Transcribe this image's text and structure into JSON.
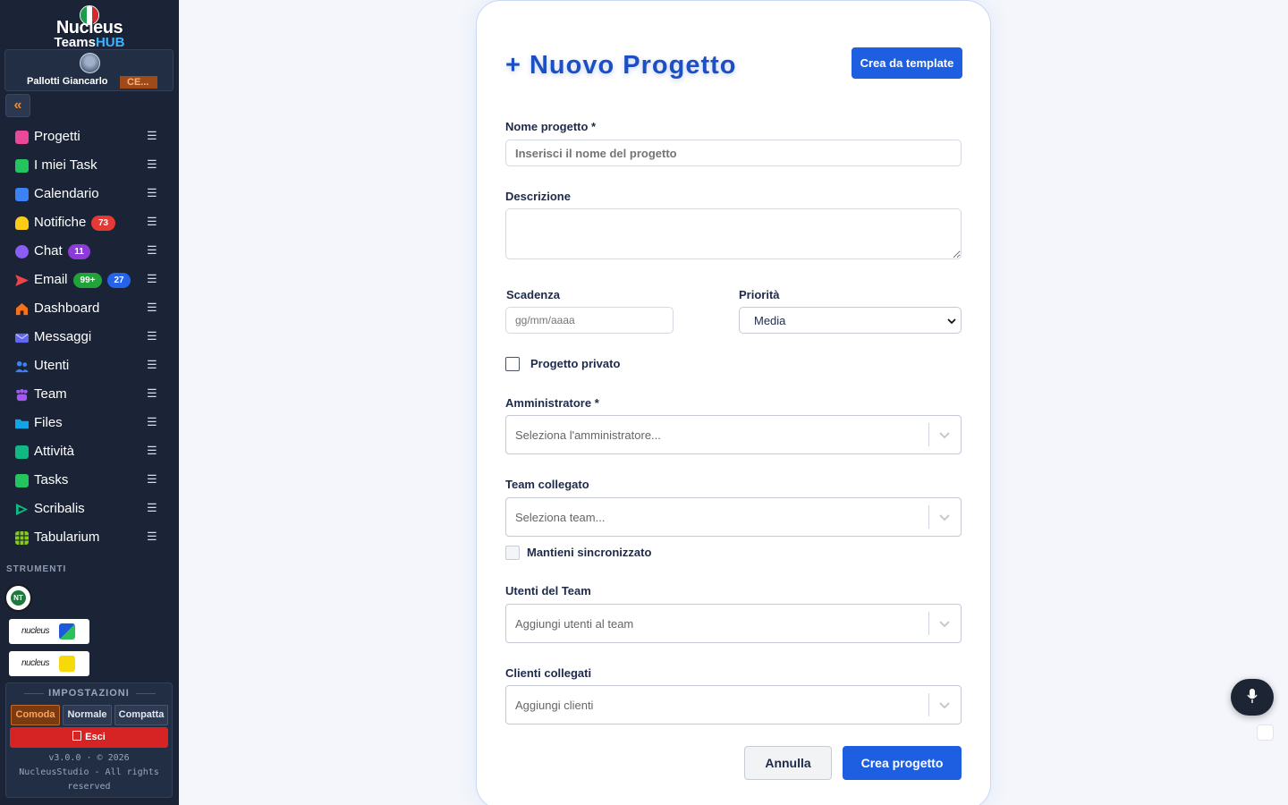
{
  "app": {
    "logo_line1": "Nucleus",
    "logo_line2a": "Teams",
    "logo_line2b": "HUB",
    "user_name": "Pallotti Giancarlo",
    "user_role": "CE..."
  },
  "sidebar": {
    "items": [
      {
        "label": "Progetti",
        "icon": "folder-pink-icon",
        "color": "#ec4899"
      },
      {
        "label": "I miei Task",
        "icon": "clipboard-check-icon",
        "color": "#22c55e"
      },
      {
        "label": "Calendario",
        "icon": "calendar-icon",
        "color": "#3b82f6"
      },
      {
        "label": "Notifiche",
        "icon": "bell-icon",
        "color": "#facc15",
        "badge": "73"
      },
      {
        "label": "Chat",
        "icon": "chat-bubble-icon",
        "color": "#8b5cf6",
        "badge": "11"
      },
      {
        "label": "Email",
        "icon": "send-icon",
        "color": "#ef4444",
        "badge": "99+",
        "badge2": "27"
      },
      {
        "label": "Dashboard",
        "icon": "home-icon",
        "color": "#f97316"
      },
      {
        "label": "Messaggi",
        "icon": "envelope-icon",
        "color": "#6366f1"
      },
      {
        "label": "Utenti",
        "icon": "users-icon",
        "color": "#3b82f6"
      },
      {
        "label": "Team",
        "icon": "team-icon",
        "color": "#a855f7"
      },
      {
        "label": "Files",
        "icon": "folder-icon",
        "color": "#0ea5e9"
      },
      {
        "label": "Attività",
        "icon": "activity-icon",
        "color": "#10b981"
      },
      {
        "label": "Tasks",
        "icon": "task-icon",
        "color": "#22c55e"
      },
      {
        "label": "Scribalis",
        "icon": "scribalis-icon",
        "color": "#10b981"
      },
      {
        "label": "Tabularium",
        "icon": "grid-icon",
        "color": "#84cc16"
      }
    ],
    "menu_glyph": "☰",
    "tools_title": "STRUMENTI",
    "tool_round_text": "NT",
    "tool1": "nucleus",
    "tool2": "nucleus",
    "settings_title": "IMPOSTAZIONI",
    "density": [
      "Comoda",
      "Normale",
      "Compatta"
    ],
    "logout": "Esci",
    "version_line1": "v3.0.0 · © 2026",
    "version_line2": "NucleusStudio - All rights",
    "version_line3": "reserved"
  },
  "form": {
    "title": "+ Nuovo Progetto",
    "template_button": "Crea da template",
    "name_label": "Nome progetto *",
    "name_placeholder": "Inserisci il nome del progetto",
    "description_label": "Descrizione",
    "deadline_label": "Scadenza",
    "deadline_placeholder": "gg/mm/aaaa",
    "priority_label": "Priorità",
    "priority_value": "Media",
    "private_label": "Progetto privato",
    "admin_label": "Amministratore *",
    "admin_placeholder": "Seleziona l'amministratore...",
    "team_label": "Team collegato",
    "team_placeholder": "Seleziona team...",
    "sync_label": "Mantieni sincronizzato",
    "team_users_label": "Utenti del Team",
    "team_users_placeholder": "Aggiungi utenti al team",
    "clients_label": "Clienti collegati",
    "clients_placeholder": "Aggiungi clienti",
    "cancel_button": "Annulla",
    "create_button": "Crea progetto"
  }
}
